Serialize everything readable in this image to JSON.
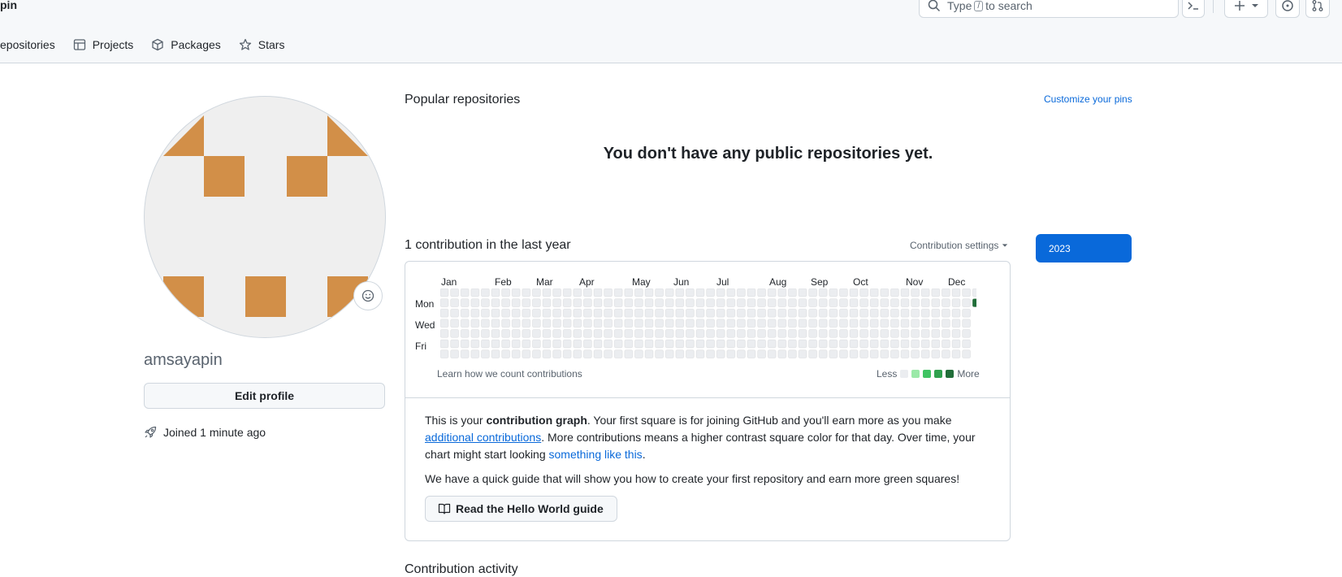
{
  "header": {
    "brand": "pin",
    "search_placeholder_pre": "Type",
    "search_key": "/",
    "search_placeholder_post": "to search"
  },
  "nav": {
    "items": [
      {
        "label": "epositories",
        "icon": "repo-icon"
      },
      {
        "label": "Projects",
        "icon": "table-icon"
      },
      {
        "label": "Packages",
        "icon": "package-icon"
      },
      {
        "label": "Stars",
        "icon": "star-icon"
      }
    ]
  },
  "profile": {
    "username": "amsayapin",
    "edit_label": "Edit profile",
    "joined": "Joined 1 minute ago"
  },
  "popular": {
    "title": "Popular repositories",
    "customize": "Customize your pins",
    "empty": "You don't have any public repositories yet."
  },
  "contributions": {
    "title": "1 contribution in the last year",
    "settings": "Contribution settings",
    "year": "2023",
    "months": [
      "Jan",
      "Feb",
      "Mar",
      "Apr",
      "May",
      "Jun",
      "Jul",
      "Aug",
      "Sep",
      "Oct",
      "Nov",
      "Dec"
    ],
    "days": [
      "Mon",
      "Wed",
      "Fri"
    ],
    "weeks": 53,
    "active_cell": {
      "week": 52,
      "day": 1,
      "level": 4
    },
    "learn": "Learn how we count contributions",
    "less": "Less",
    "more": "More",
    "colors": {
      "empty": "#ebedf0",
      "l1": "#9be9a8",
      "l2": "#40c463",
      "l3": "#30a14e",
      "l4": "#216e39"
    }
  },
  "info": {
    "p1_a": "This is your ",
    "p1_b": "contribution graph",
    "p1_c": ". Your first square is for joining GitHub and you'll earn more as you make ",
    "p1_link1": "additional contributions",
    "p1_d": ". More contributions means a higher contrast square color for that day. Over time, your chart might start looking ",
    "p1_link2": "something like this",
    "p1_e": ".",
    "p2": "We have a quick guide that will show you how to create your first repository and earn more green squares!",
    "guide_label": "Read the Hello World guide"
  },
  "activity": {
    "title": "Contribution activity"
  }
}
